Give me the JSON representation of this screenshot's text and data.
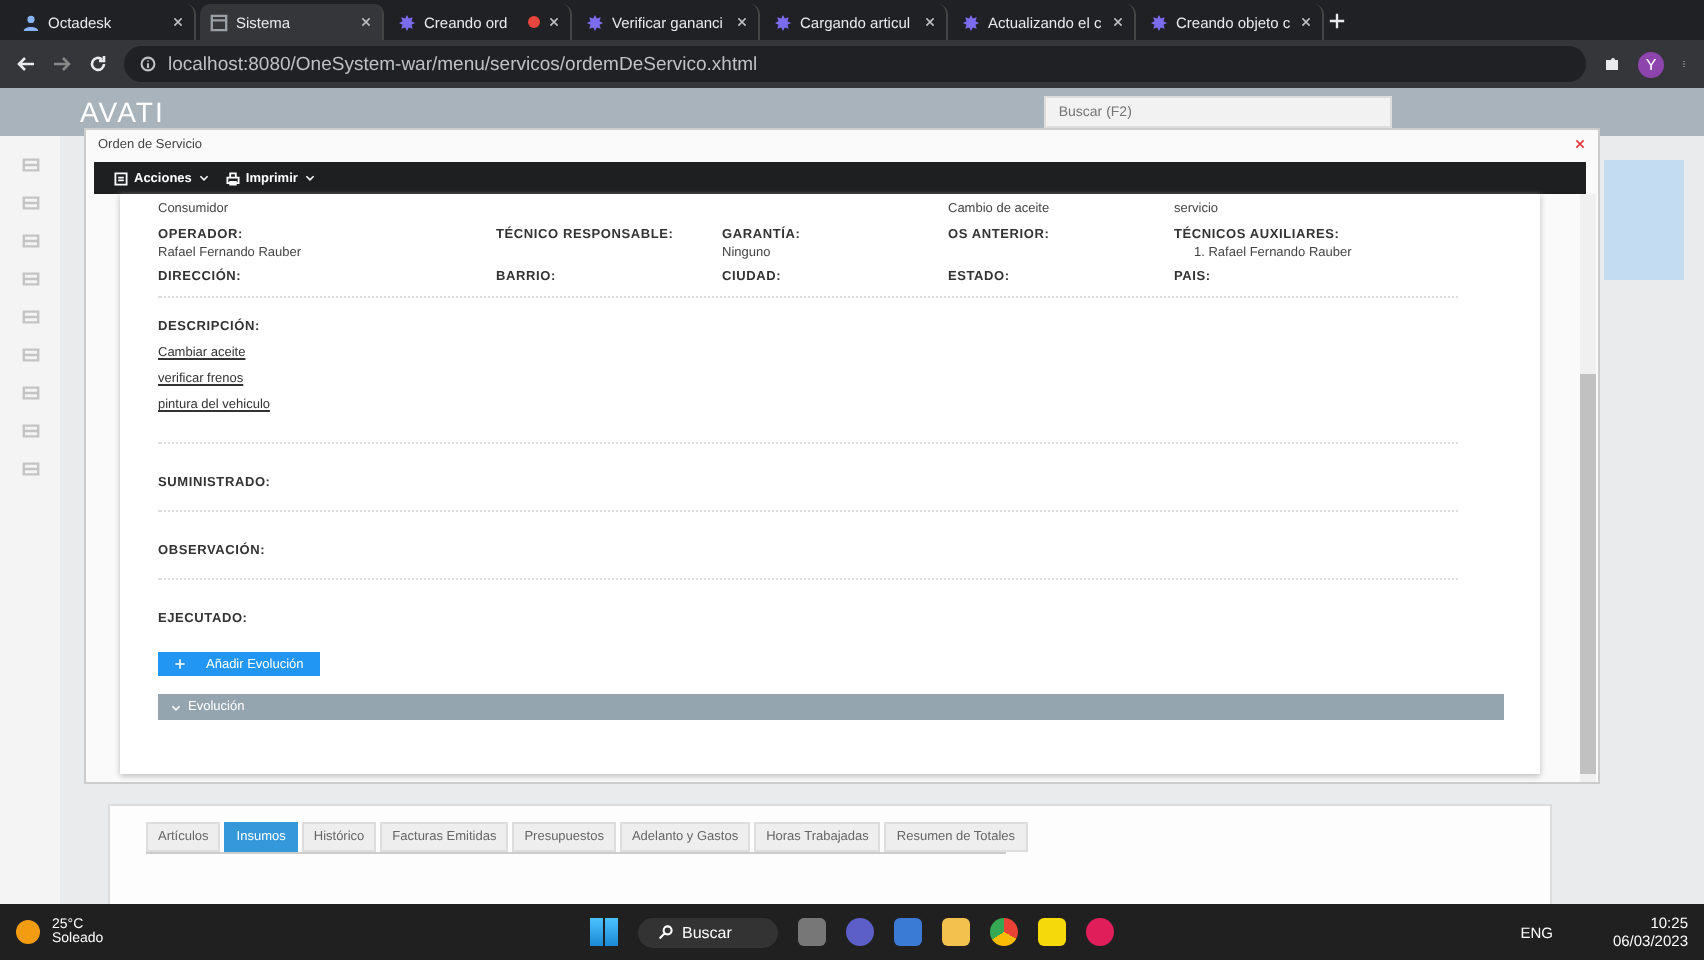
{
  "browser": {
    "tabs": [
      {
        "title": "Octadesk",
        "kind": "person",
        "selected": false,
        "recording": false
      },
      {
        "title": "Sistema",
        "kind": "page",
        "selected": true,
        "recording": false
      },
      {
        "title": "Creando ord",
        "kind": "gear",
        "selected": false,
        "recording": true
      },
      {
        "title": "Verificar gananci",
        "kind": "gear",
        "selected": false,
        "recording": false
      },
      {
        "title": "Cargando articul",
        "kind": "gear",
        "selected": false,
        "recording": false
      },
      {
        "title": "Actualizando el c",
        "kind": "gear",
        "selected": false,
        "recording": false
      },
      {
        "title": "Creando objeto c",
        "kind": "gear",
        "selected": false,
        "recording": false
      }
    ],
    "address": "localhost:8080/OneSystem-war/menu/servicos/ordemDeServico.xhtml",
    "profile": "Y"
  },
  "app": {
    "logo": "AVATI",
    "search": {
      "placeholder": "Buscar (F2)"
    },
    "bottom_tabs": [
      {
        "label": "Artículos",
        "selected": false
      },
      {
        "label": "Insumos",
        "selected": true
      },
      {
        "label": "Histórico",
        "selected": false
      },
      {
        "label": "Facturas Emitidas",
        "selected": false
      },
      {
        "label": "Presupuestos",
        "selected": false
      },
      {
        "label": "Adelanto y Gastos",
        "selected": false
      },
      {
        "label": "Horas Trabajadas",
        "selected": false
      },
      {
        "label": "Resumen de Totales",
        "selected": false
      }
    ]
  },
  "dialog": {
    "title": "Orden de Servicio",
    "toolbar": [
      "Acciones",
      "Imprimir"
    ],
    "top_values": [
      "Consumidor",
      "Cambio de aceite",
      "servicio"
    ],
    "fields": [
      {
        "label": "OPERADOR:",
        "value": "Rafael Fernando Rauber"
      },
      {
        "label": "TÉCNICO RESPONSABLE:"
      },
      {
        "label": "GARANTÍA:",
        "value": "Ninguno"
      },
      {
        "label": "OS ANTERIOR:"
      },
      {
        "label": "TÉCNICOS AUXILIARES:",
        "list": [
          {
            "number": "1.",
            "name": "Rafael Fernando Rauber"
          }
        ]
      },
      {
        "label": "DIRECCIÓN:"
      },
      {
        "label": "BARRIO:"
      },
      {
        "label": "CIUDAD:"
      },
      {
        "label": "ESTADO:"
      },
      {
        "label": "PAIS:"
      }
    ],
    "description": {
      "label": "DESCRIPCIÓN:",
      "items": [
        "Cambiar aceite",
        "verificar frenos",
        "pintura del vehiculo"
      ]
    },
    "sections": [
      "SUMINISTRADO:",
      "OBSERVACIÓN:",
      "EJECUTADO:"
    ],
    "add_button": "Añadir Evolución",
    "panel": {
      "title": "Evolución",
      "expanded": true
    }
  },
  "taskbar": {
    "temperature": "25°C",
    "weather": "Soleado",
    "search": "Buscar",
    "language": "ENG",
    "time": "10:25",
    "date": "06/03/2023"
  }
}
